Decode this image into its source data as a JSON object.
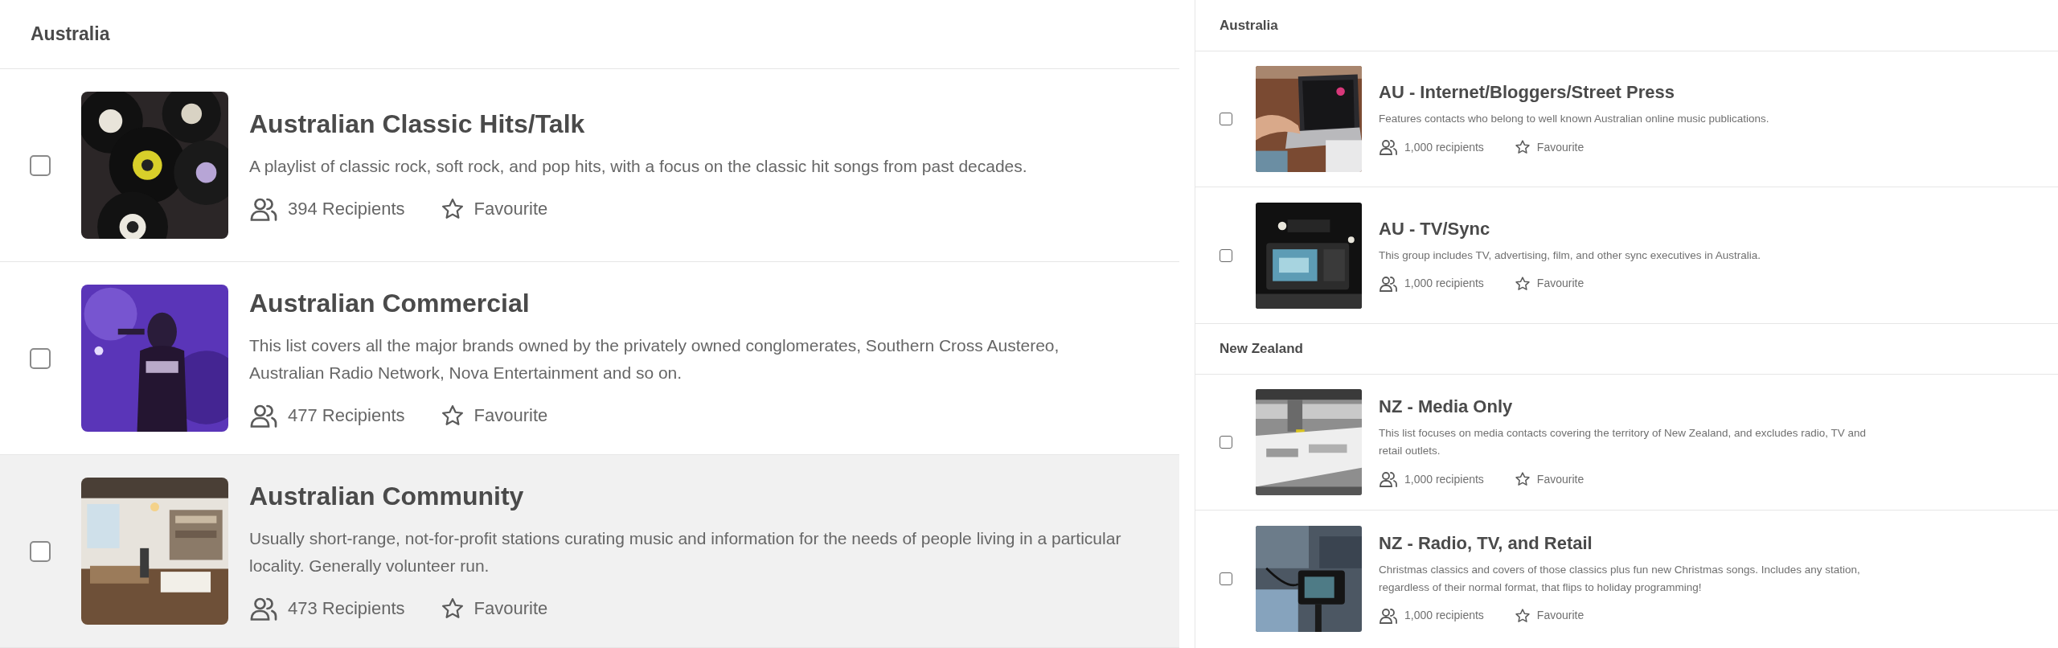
{
  "left_panel": {
    "heading": "Australia",
    "items": [
      {
        "title": "Australian Classic Hits/Talk",
        "description": "A playlist of classic rock, soft rock, and pop hits, with a focus on the classic hit songs from past decades.",
        "recipients": "394 Recipients",
        "favourite": "Favourite",
        "checked": false,
        "highlighted": false
      },
      {
        "title": "Australian Commercial",
        "description": "This list covers all the major brands owned by the privately owned conglomerates, Southern Cross Austereo, Australian Radio Network, Nova Entertainment and so on.",
        "recipients": "477 Recipients",
        "favourite": "Favourite",
        "checked": false,
        "highlighted": false
      },
      {
        "title": "Australian Community",
        "description": "Usually short-range, not-for-profit stations curating music and information for the needs of people living in a particular locality. Generally volunteer run.",
        "recipients": "473 Recipients",
        "favourite": "Favourite",
        "checked": false,
        "highlighted": true
      }
    ]
  },
  "right_panel": {
    "sections": [
      {
        "heading": "Australia",
        "items": [
          {
            "title": "AU - Internet/Bloggers/Street Press",
            "description": "Features contacts who belong to well known Australian online music publications.",
            "recipients": "1,000 recipients",
            "favourite": "Favourite",
            "checked": false
          },
          {
            "title": "AU - TV/Sync",
            "description": "This group includes TV, advertising, film, and other sync executives in Australia.",
            "recipients": "1,000 recipients",
            "favourite": "Favourite",
            "checked": false
          }
        ]
      },
      {
        "heading": "New Zealand",
        "items": [
          {
            "title": "NZ - Media Only",
            "description": "This list focuses on media contacts covering the territory of New Zealand, and excludes radio, TV and retail outlets.",
            "recipients": "1,000 recipients",
            "favourite": "Favourite",
            "checked": false
          },
          {
            "title": "NZ - Radio, TV, and Retail",
            "description": "Christmas classics and covers of those classics plus fun new Christmas songs. Includes any station, regardless of their normal format, that flips to holiday programming!",
            "recipients": "1,000 recipients",
            "favourite": "Favourite",
            "checked": false
          }
        ]
      }
    ]
  }
}
